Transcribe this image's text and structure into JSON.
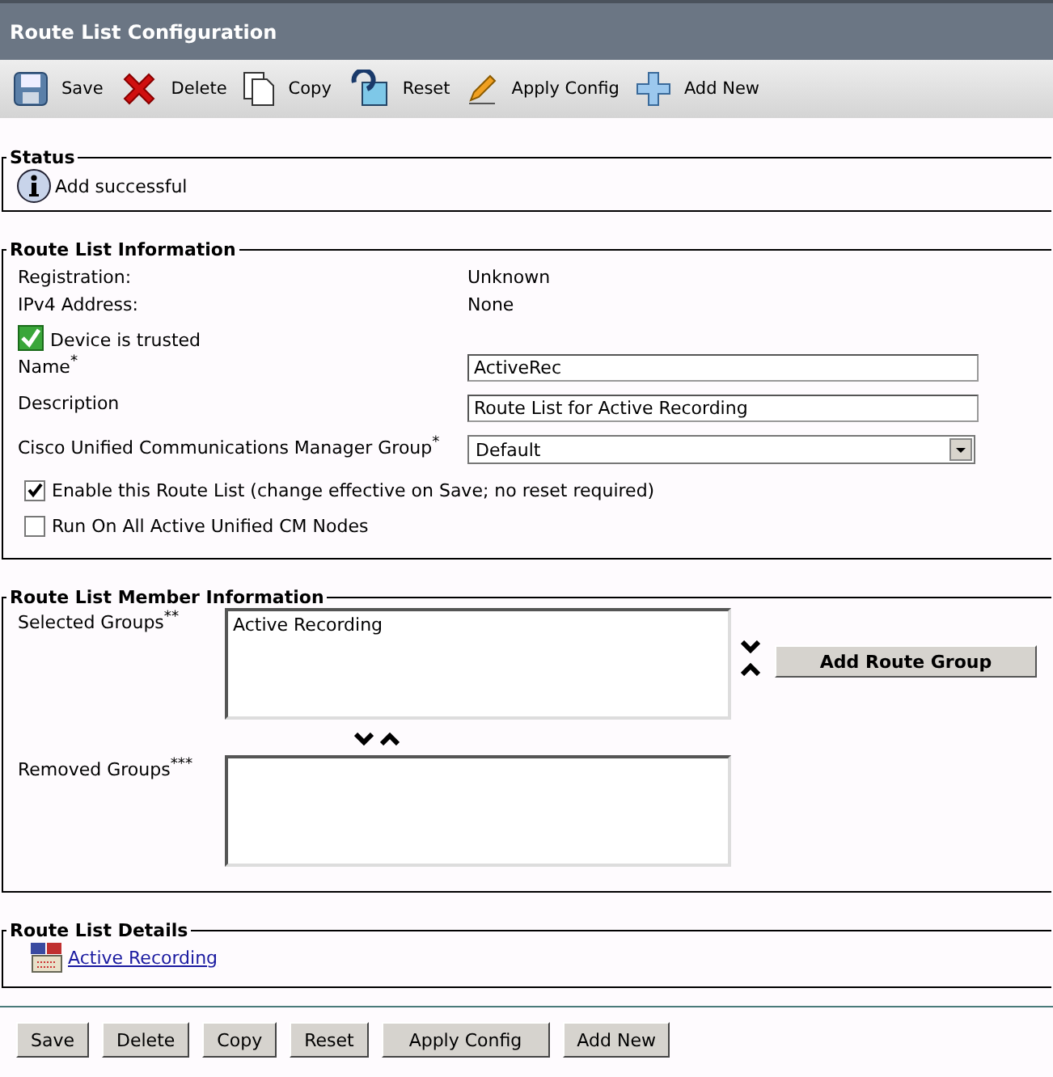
{
  "window": {
    "title": "Route List Configuration"
  },
  "toolbar": [
    {
      "kind": "save",
      "label": "Save"
    },
    {
      "kind": "delete",
      "label": "Delete"
    },
    {
      "kind": "copy",
      "label": "Copy"
    },
    {
      "kind": "reset",
      "label": "Reset"
    },
    {
      "kind": "apply",
      "label": "Apply Config"
    },
    {
      "kind": "add",
      "label": "Add New"
    }
  ],
  "status": {
    "title": "Status",
    "message": "Add successful"
  },
  "route_list_information": {
    "title": "Route List Information",
    "readouts": [
      {
        "label": "Registration:",
        "value": "Unknown"
      },
      {
        "label": "IPv4 Address:",
        "value": "None"
      }
    ],
    "trusted": {
      "label": "Device is trusted",
      "trusted": true
    },
    "fields": [
      {
        "kind": "text",
        "label": "Name$^{*}$",
        "value": "ActiveRec"
      },
      {
        "kind": "text",
        "label": "Description",
        "value": "Route List for Active Recording"
      },
      {
        "kind": "select",
        "label": "Cisco Unified Communications Manager Group$^{*}$",
        "value": "Default"
      }
    ],
    "options": [
      {
        "label": "Enable this Route List (change effective on Save; no reset required)",
        "checked": true
      },
      {
        "label": "Run On All Active Unified CM Nodes",
        "checked": false
      }
    ]
  },
  "route_list_member_information": {
    "title": "Route List Member Information",
    "selected_groups": {
      "label": "Selected Groups$^{**}$",
      "items": [
        {
          "text": "Active Recording",
          "selected": false
        }
      ]
    },
    "removed_groups": {
      "label": "Removed Groups$^{***}$"
    },
    "add_button": "Add Route Group"
  },
  "route_list_details": {
    "title": "Route List Details",
    "links": [
      "Active Recording"
    ]
  },
  "buttons": [
    "Save",
    "Delete",
    "Copy",
    "Reset",
    "Apply Config",
    "Add New"
  ]
}
